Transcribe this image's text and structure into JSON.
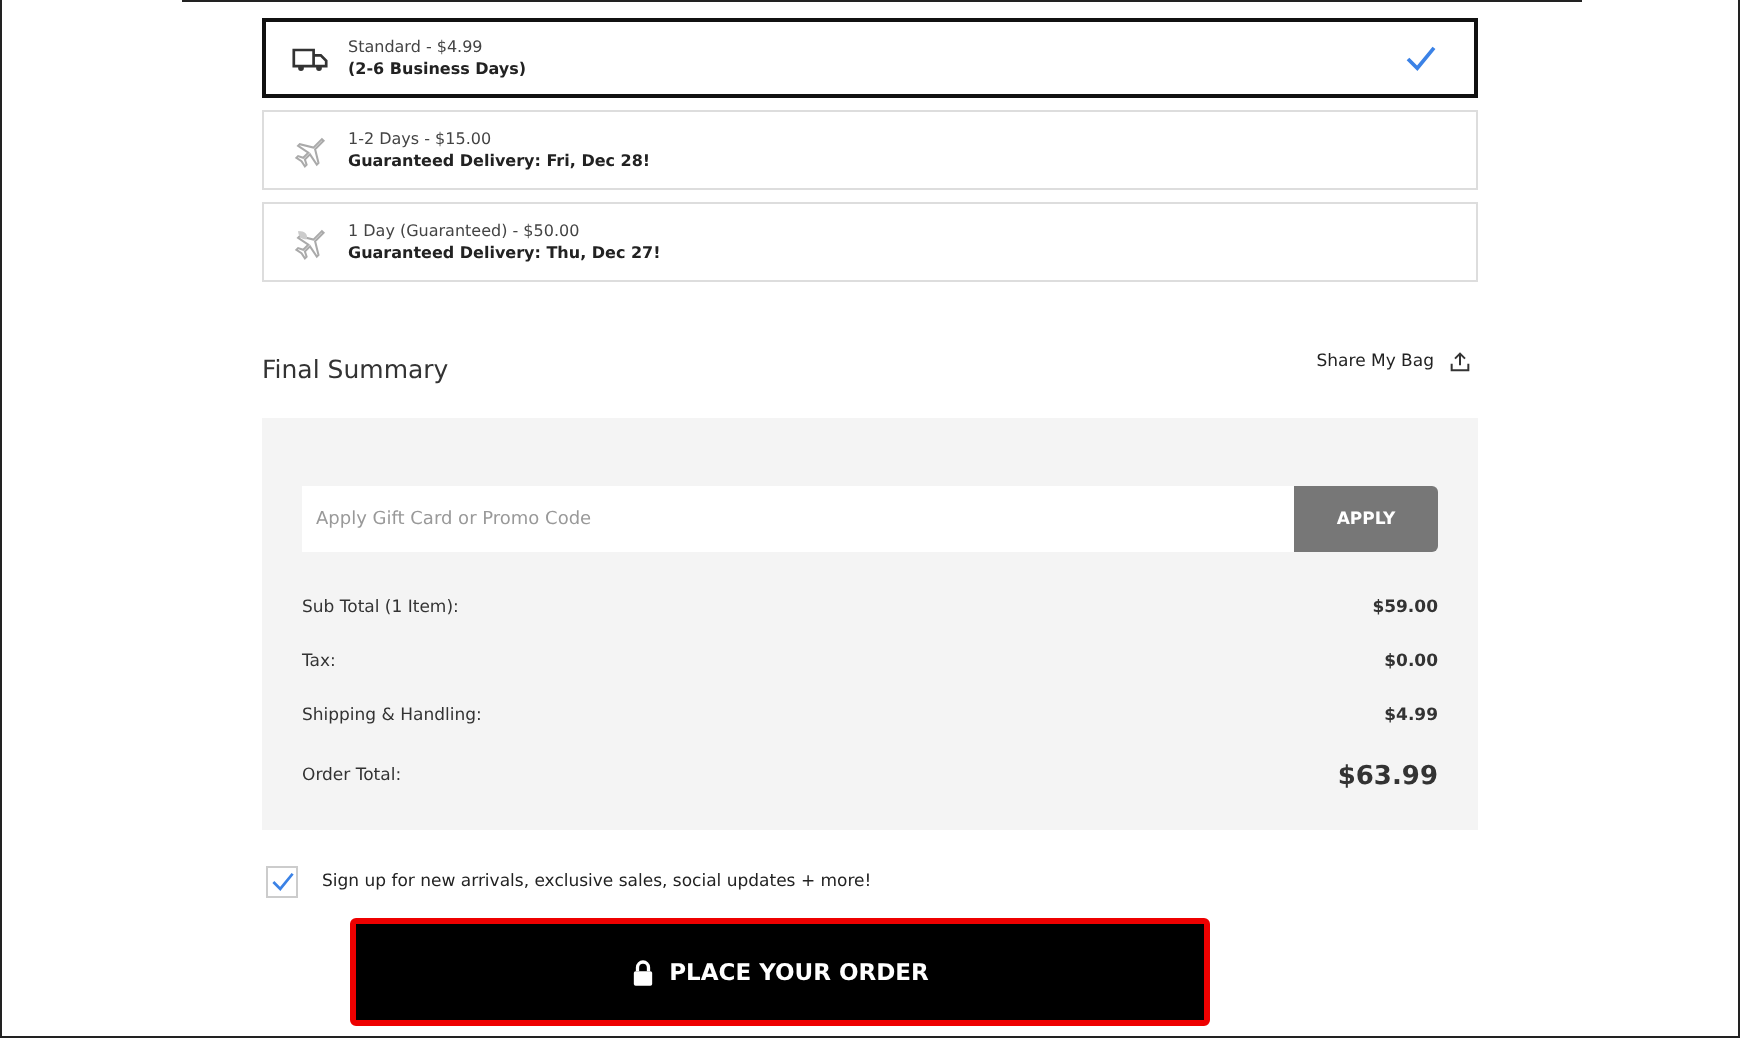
{
  "shipping_options": [
    {
      "kind": "truck",
      "line1": "Standard  - $4.99",
      "line2": "(2-6 Business Days)",
      "selected": true
    },
    {
      "kind": "plane",
      "line1": "1-2 Days  - $15.00",
      "line2": "Guaranteed Delivery: Fri, Dec 28!",
      "selected": false
    },
    {
      "kind": "plane-leaf",
      "line1": "1 Day (Guaranteed)  - $50.00",
      "line2": "Guaranteed Delivery: Thu, Dec 27!",
      "selected": false
    }
  ],
  "summary": {
    "title": "Final Summary",
    "share_label": "Share My Bag",
    "promo": {
      "placeholder": "Apply Gift Card or Promo Code",
      "button": "APPLY"
    },
    "rows": [
      {
        "label": "Sub Total (1 Item):",
        "value": "$59.00",
        "kind": "line"
      },
      {
        "label": "Tax:",
        "value": "$0.00",
        "kind": "line"
      },
      {
        "label": "Shipping & Handling:",
        "value": "$4.99",
        "kind": "line"
      },
      {
        "label": "Order Total:",
        "value": "$63.99",
        "kind": "total"
      }
    ]
  },
  "signup": {
    "label": "Sign up for new arrivals, exclusive sales, social updates + more!",
    "checked": true
  },
  "order_button": {
    "label": "PLACE YOUR ORDER",
    "highlighted": true
  }
}
